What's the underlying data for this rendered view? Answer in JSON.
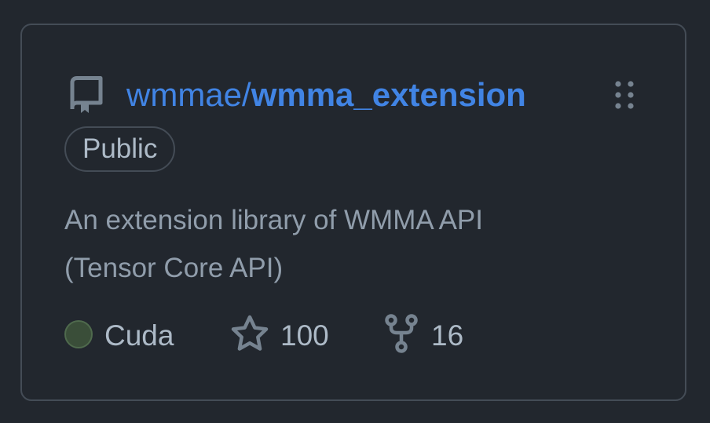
{
  "repo": {
    "owner": "wmmae/",
    "name": "wmma_extension",
    "visibility": "Public",
    "description_line1": "An extension library of WMMA API",
    "description_line2": "(Tensor Core API)",
    "language": "Cuda",
    "stars": "100",
    "forks": "16"
  },
  "icons": {
    "repo": "repo-icon",
    "drag": "grabber-icon",
    "star": "star-icon",
    "fork": "fork-icon"
  },
  "colors": {
    "background": "#22272e",
    "border": "#444c56",
    "link": "#4184e4",
    "text_muted": "#909dab",
    "text": "#adbac7",
    "language_cuda": "#3a4e39"
  }
}
